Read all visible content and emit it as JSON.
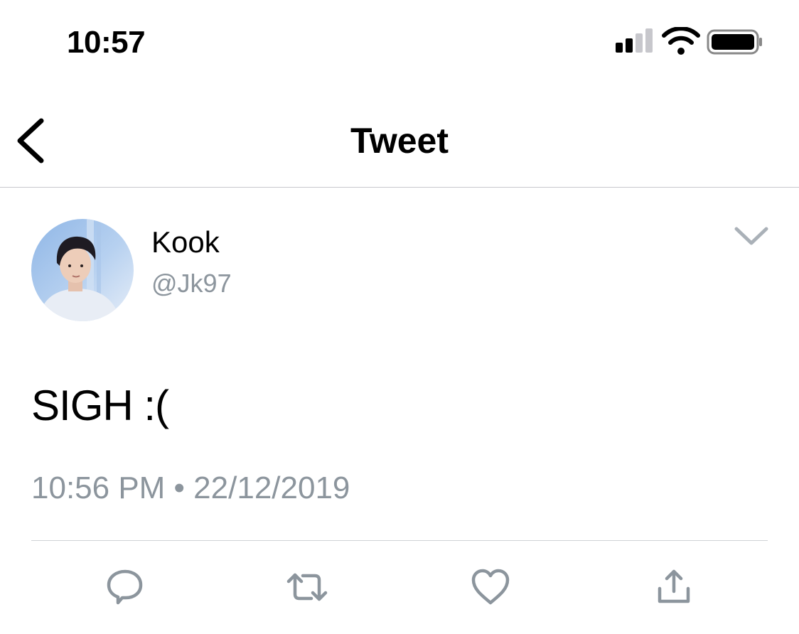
{
  "status_bar": {
    "time": "10:57",
    "icons": [
      "signal-icon",
      "wifi-icon",
      "battery-icon"
    ]
  },
  "nav": {
    "title": "Tweet",
    "back_icon": "chevron-left-icon"
  },
  "tweet": {
    "author": {
      "display_name": "Kook",
      "handle": "@Jk97"
    },
    "text": "SIGH :(",
    "timestamp": "10:56 PM • 22/12/2019",
    "menu_icon": "chevron-down-icon"
  },
  "actions": [
    {
      "icon": "reply-icon"
    },
    {
      "icon": "retweet-icon"
    },
    {
      "icon": "like-icon"
    },
    {
      "icon": "share-icon"
    }
  ],
  "colors": {
    "secondary_text": "#8c959d",
    "icon_gray": "#8c959d",
    "divider": "#c8c8cc"
  }
}
